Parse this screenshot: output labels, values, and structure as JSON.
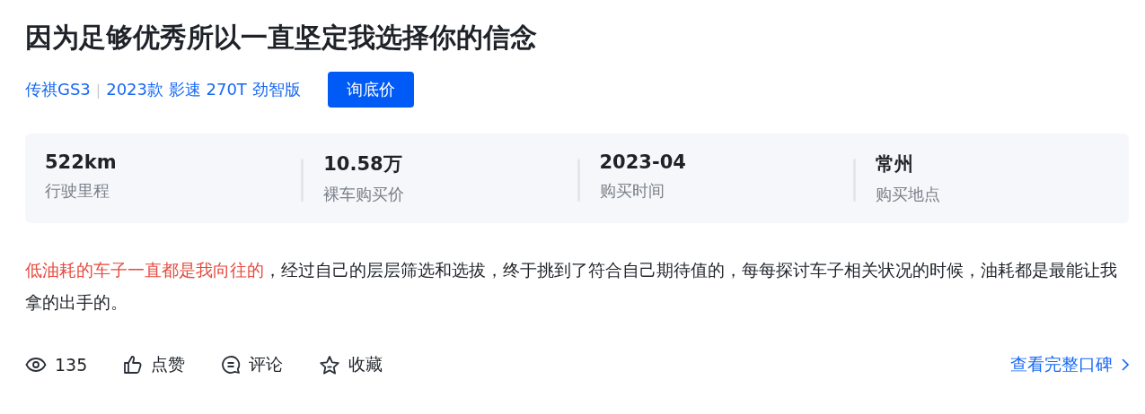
{
  "title": "因为足够优秀所以一直坚定我选择你的信念",
  "car": {
    "model": "传祺GS3",
    "separator": "|",
    "trim": "2023款 影速 270T 劲智版",
    "button": "询底价"
  },
  "stats": [
    {
      "value": "522km",
      "label": "行驶里程"
    },
    {
      "value": "10.58万",
      "label": "裸车购买价"
    },
    {
      "value": "2023-04",
      "label": "购买时间"
    },
    {
      "value": "常州",
      "label": "购买地点"
    }
  ],
  "review": {
    "highlight": "低油耗的车子一直都是我向往的",
    "text": "，经过自己的层层筛选和选拔，终于挑到了符合自己期待值的，每每探讨车子相关状况的时候，油耗都是最能让我拿的出手的。"
  },
  "actions": [
    {
      "kind": "views",
      "label": "135"
    },
    {
      "kind": "like",
      "label": "点赞"
    },
    {
      "kind": "comment",
      "label": "评论"
    },
    {
      "kind": "favorite",
      "label": "收藏"
    }
  ],
  "more_link": "查看完整口碑"
}
